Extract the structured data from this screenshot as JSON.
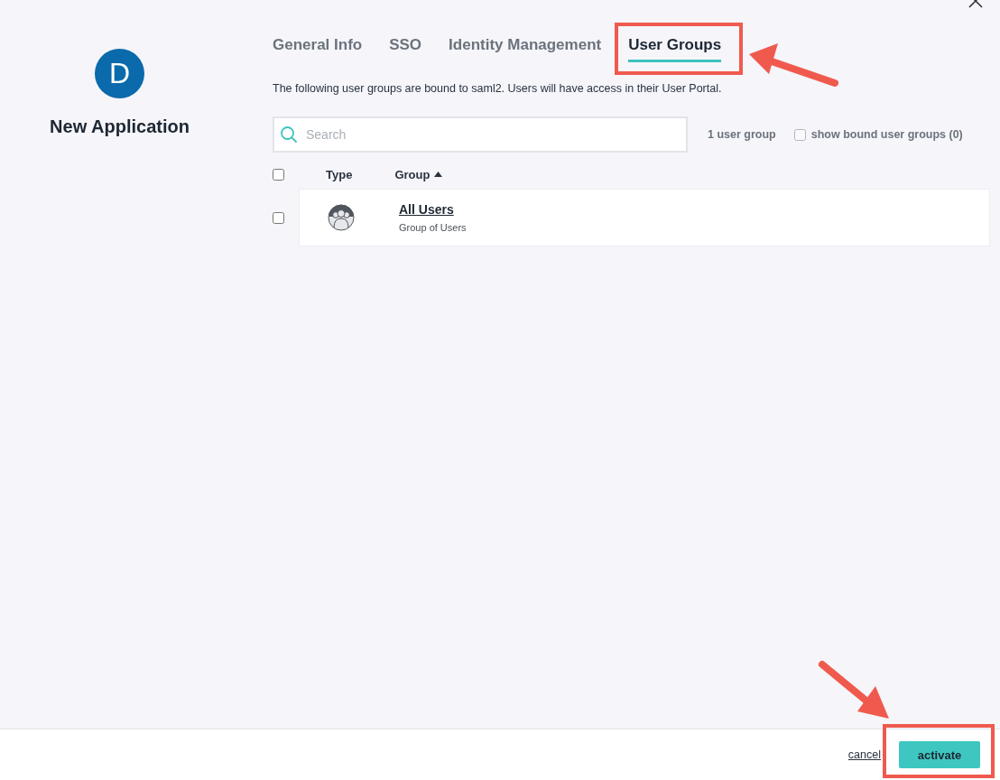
{
  "app": {
    "avatar_letter": "D",
    "name": "New Application"
  },
  "tabs": [
    {
      "label": "General Info",
      "selected": false
    },
    {
      "label": "SSO",
      "selected": false
    },
    {
      "label": "Identity Management",
      "selected": false
    },
    {
      "label": "User Groups",
      "selected": true
    }
  ],
  "description": "The following user groups are bound to saml2. Users will have access in their User Portal.",
  "search": {
    "placeholder": "Search"
  },
  "group_count": "1 user group",
  "show_bound": {
    "label": "show bound user groups (0)",
    "checked": false
  },
  "table": {
    "select_all": false,
    "columns": [
      "Type",
      "Group"
    ],
    "rows": [
      {
        "name": "All Users",
        "subtitle": "Group of Users",
        "checked": false
      }
    ]
  },
  "footer": {
    "cancel": "cancel",
    "activate": "activate"
  }
}
